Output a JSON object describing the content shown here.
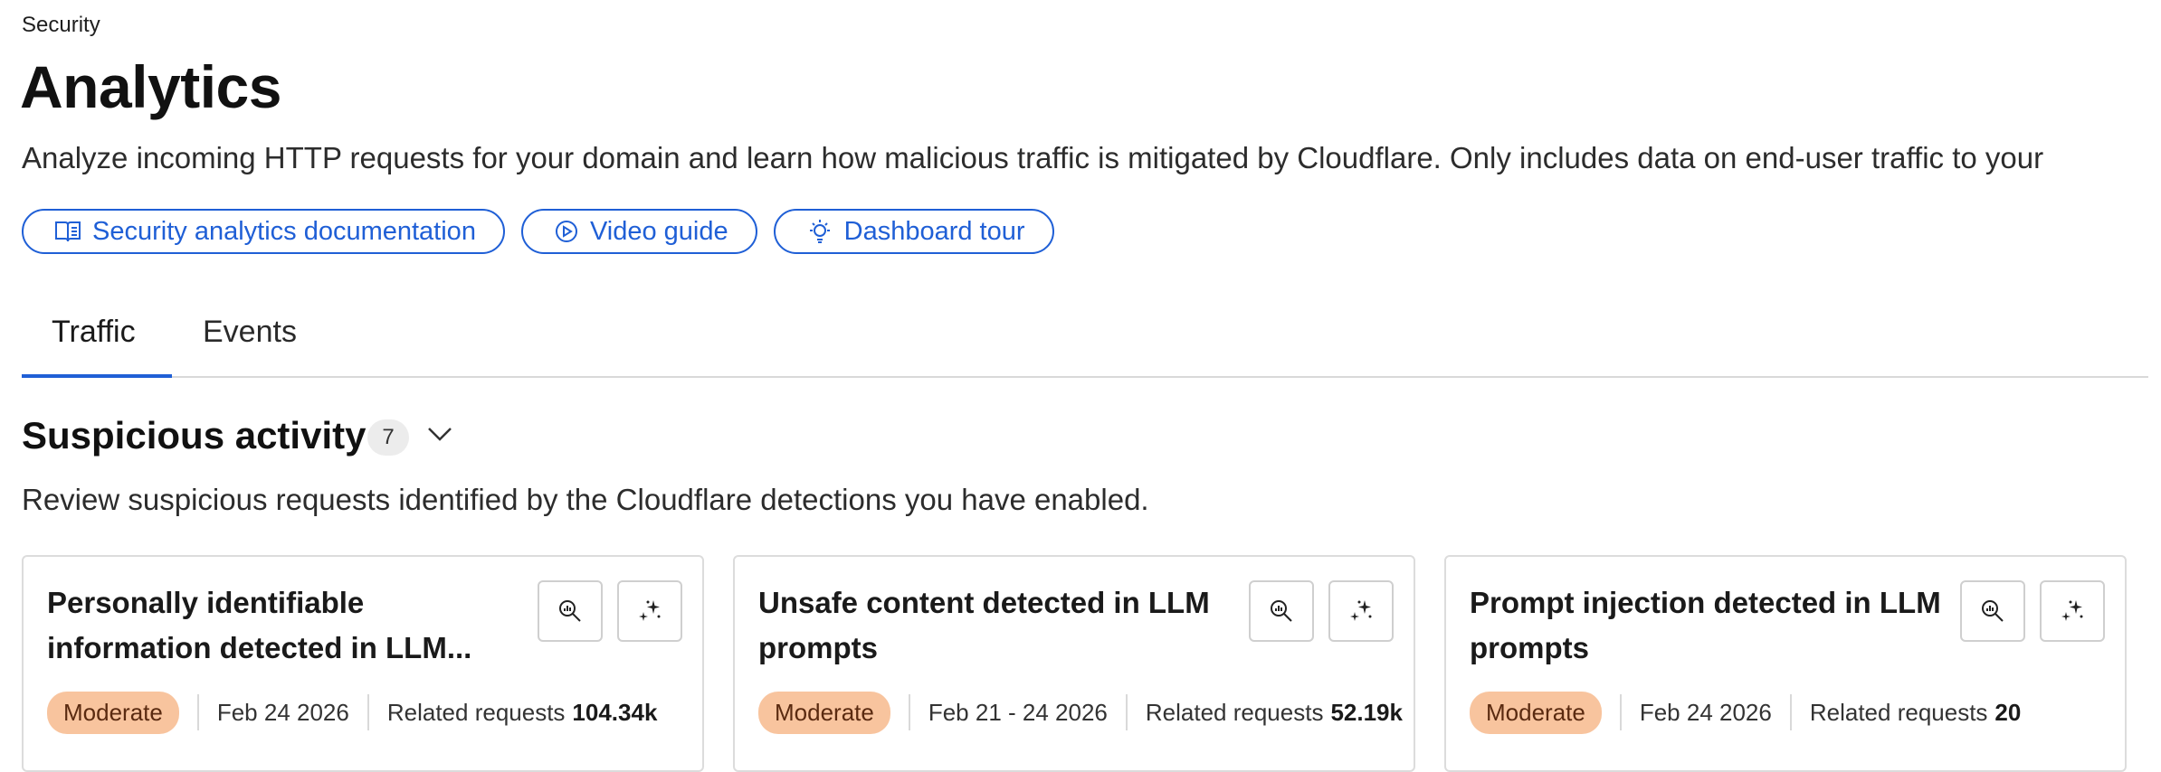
{
  "breadcrumb": "Security",
  "page_title": "Analytics",
  "description": "Analyze incoming HTTP requests for your domain and learn how malicious traffic is mitigated by Cloudflare. Only includes data on end-user traffic to your",
  "links": [
    {
      "label": "Security analytics documentation",
      "icon": "book-icon"
    },
    {
      "label": "Video guide",
      "icon": "play-circle-icon"
    },
    {
      "label": "Dashboard tour",
      "icon": "lightbulb-icon"
    }
  ],
  "tabs": [
    {
      "label": "Traffic",
      "active": true
    },
    {
      "label": "Events",
      "active": false
    }
  ],
  "suspicious": {
    "title": "Suspicious activity",
    "count": "7",
    "description": "Review suspicious requests identified by the Cloudflare detections you have enabled.",
    "cards": [
      {
        "title": "Personally identifiable information detected in LLM...",
        "severity": "Moderate",
        "date": "Feb 24 2026",
        "related_label": "Related requests",
        "related_value": "104.34k"
      },
      {
        "title": "Unsafe content detected in LLM prompts",
        "severity": "Moderate",
        "date": "Feb 21 - 24 2026",
        "related_label": "Related requests",
        "related_value": "52.19k"
      },
      {
        "title": "Prompt injection detected in LLM prompts",
        "severity": "Moderate",
        "date": "Feb 24 2026",
        "related_label": "Related requests",
        "related_value": "20"
      }
    ]
  },
  "colors": {
    "accent": "#1f5fd6",
    "moderate_badge": "#f8c49e"
  }
}
